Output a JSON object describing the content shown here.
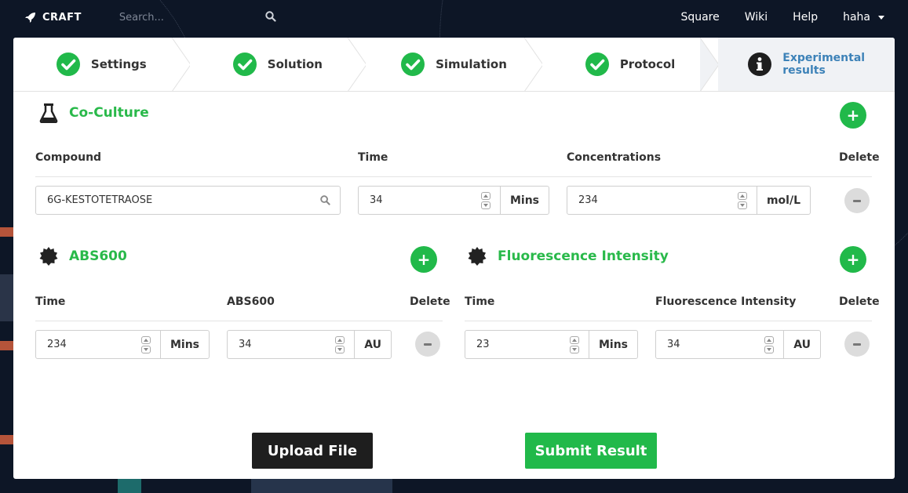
{
  "nav": {
    "brand": "CRAFT",
    "search_placeholder": "Search...",
    "links": [
      "Square",
      "Wiki",
      "Help"
    ],
    "user": "haha"
  },
  "steps": [
    {
      "label": "Settings",
      "status": "complete"
    },
    {
      "label": "Solution",
      "status": "complete"
    },
    {
      "label": "Simulation",
      "status": "complete"
    },
    {
      "label": "Protocol",
      "status": "complete"
    },
    {
      "label_line1": "Experimental",
      "label_line2": "results",
      "status": "active"
    }
  ],
  "coculture": {
    "title": "Co-Culture",
    "headers": {
      "compound": "Compound",
      "time": "Time",
      "concentrations": "Concentrations",
      "delete": "Delete"
    },
    "row": {
      "compound": "6G-KESTOTETRAOSE",
      "time": "34",
      "time_unit": "Mins",
      "concentration": "234",
      "concentration_unit": "mol/L"
    }
  },
  "abs600": {
    "title": "ABS600",
    "headers": {
      "time": "Time",
      "value": "ABS600",
      "delete": "Delete"
    },
    "row": {
      "time": "234",
      "time_unit": "Mins",
      "value": "34",
      "value_unit": "AU"
    }
  },
  "fluorescence": {
    "title": "Fluorescence Intensity",
    "headers": {
      "time": "Time",
      "value": "Fluorescence Intensity",
      "delete": "Delete"
    },
    "row": {
      "time": "23",
      "time_unit": "Mins",
      "value": "34",
      "value_unit": "AU"
    }
  },
  "actions": {
    "upload": "Upload File",
    "submit": "Submit Result"
  },
  "colors": {
    "accent_green": "#21b94a",
    "active_step_text": "#3d82b8",
    "dark_button": "#1e1e1e",
    "background": "#0d1626"
  },
  "add_symbol": "+"
}
